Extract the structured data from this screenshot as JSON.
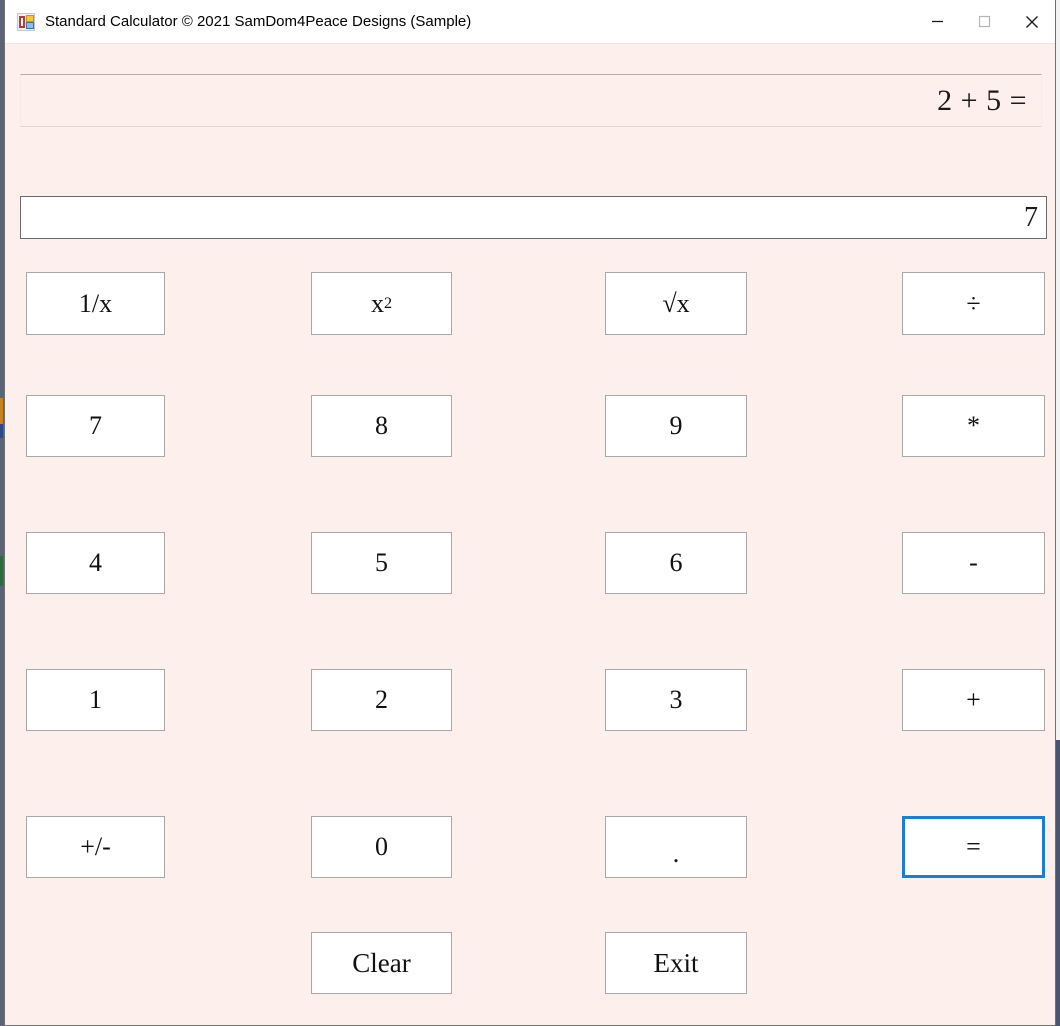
{
  "window": {
    "title": "Standard Calculator © 2021 SamDom4Peace Designs (Sample)",
    "icon": "winforms-app-icon",
    "controls": [
      {
        "name": "minimize",
        "label": "Minimize",
        "glyph": "minimize-icon"
      },
      {
        "name": "maximize",
        "label": "Maximize",
        "glyph": "maximize-icon"
      },
      {
        "name": "close",
        "label": "Close",
        "glyph": "close-icon"
      }
    ]
  },
  "display": {
    "expression": "2 + 5 =",
    "result": "7",
    "expression_placeholder": "",
    "result_placeholder": ""
  },
  "colors": {
    "form_background": "#fdf0ec",
    "button_face": "#ffffff",
    "button_border": "#a8a8a8",
    "focus_border": "#1a7fd4",
    "titlebar": "#ffffff",
    "text": "#111111"
  },
  "keypad": {
    "rows": [
      [
        {
          "name": "reciprocal",
          "label": "1/x",
          "html": "1/x"
        },
        {
          "name": "square",
          "label": "x²",
          "html": "x<sup>2</sup>"
        },
        {
          "name": "square-root",
          "label": "√x",
          "html": "√x"
        },
        {
          "name": "divide",
          "label": "÷",
          "html": "÷"
        }
      ],
      [
        {
          "name": "digit-7",
          "label": "7",
          "html": "7"
        },
        {
          "name": "digit-8",
          "label": "8",
          "html": "8"
        },
        {
          "name": "digit-9",
          "label": "9",
          "html": "9"
        },
        {
          "name": "multiply",
          "label": "*",
          "html": "*"
        }
      ],
      [
        {
          "name": "digit-4",
          "label": "4",
          "html": "4"
        },
        {
          "name": "digit-5",
          "label": "5",
          "html": "5"
        },
        {
          "name": "digit-6",
          "label": "6",
          "html": "6"
        },
        {
          "name": "subtract",
          "label": "-",
          "html": "-"
        }
      ],
      [
        {
          "name": "digit-1",
          "label": "1",
          "html": "1"
        },
        {
          "name": "digit-2",
          "label": "2",
          "html": "2"
        },
        {
          "name": "digit-3",
          "label": "3",
          "html": "3"
        },
        {
          "name": "add",
          "label": "+",
          "html": "+"
        }
      ],
      [
        {
          "name": "sign-toggle",
          "label": "+/-",
          "html": "+/-"
        },
        {
          "name": "digit-0",
          "label": "0",
          "html": "0"
        },
        {
          "name": "decimal-point",
          "label": ".",
          "html": "."
        },
        {
          "name": "equals",
          "label": "=",
          "html": "=",
          "focused": true
        }
      ]
    ],
    "actions": [
      {
        "name": "clear",
        "label": "Clear",
        "html": "Clear"
      },
      {
        "name": "exit",
        "label": "Exit",
        "html": "Exit"
      }
    ]
  }
}
